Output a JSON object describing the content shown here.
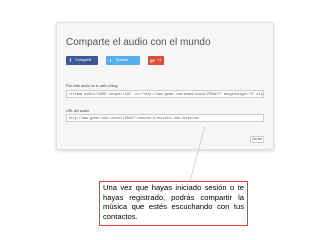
{
  "dialog": {
    "title": "Comparte el audio con el mundo",
    "share_buttons": [
      {
        "icon": "f",
        "label": "Compartir",
        "color": "#3b5998"
      },
      {
        "icon": "t",
        "label": "Twittear",
        "color": "#55acee"
      },
      {
        "icon": "g+",
        "label": "+1",
        "color": "#dd4b39"
      }
    ],
    "embed": {
      "label": "Pon este audio en tu web o blog:",
      "value": "<iframe width=\"100%\" height=\"110\" src=\"http://www.goear.com/embed/sound/2f9b9f7\" marginheight=\"0\" align=\"top\" scr"
    },
    "url": {
      "label": "URL del audio:",
      "value": "http://www.goear.com/listen/2f9b9f7/cancion-a-escribir-una-direccion"
    },
    "close_label": "Cerrar"
  },
  "annotation": {
    "text": "Una vez que hayas iniciado sesión o te hayas registrado, podrás compartir la música que estés escuchando con tus contactos.",
    "border_color": "#e0413a"
  }
}
